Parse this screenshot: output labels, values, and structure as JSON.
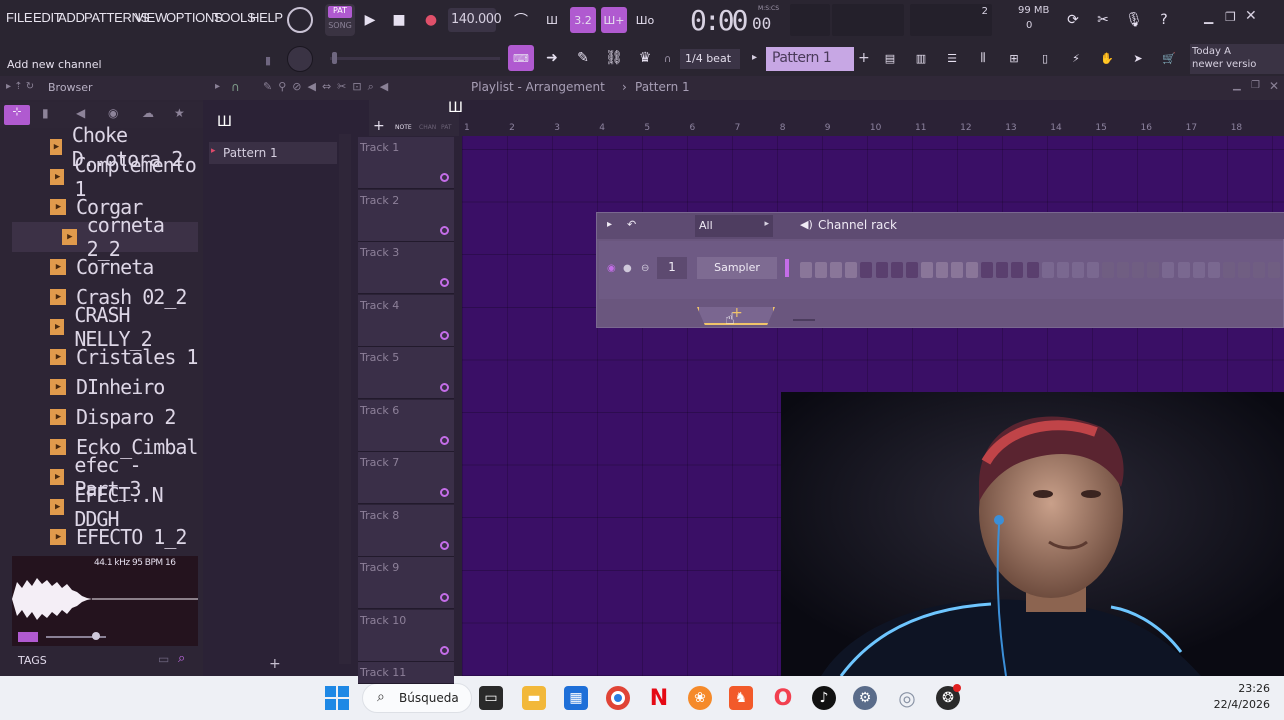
{
  "menu": {
    "items": [
      "FILE",
      "EDIT",
      "ADD",
      "PATTERNS",
      "VIEW",
      "OPTIONS",
      "TOOLS",
      "HELP"
    ]
  },
  "transport": {
    "pat_label": "PAT",
    "song_label": "SONG",
    "tempo": "140.000",
    "time": "0:00",
    "time_sub": "00",
    "time_unit": "M:S:CS",
    "cpu_val": "2",
    "mem": "99 MB",
    "mem_sub": "0",
    "small_val": "3.2"
  },
  "hint": {
    "text": "Add new channel"
  },
  "toolbar2": {
    "snap": "1/4 beat",
    "pattern": "Pattern 1",
    "news_line1": "Today  A",
    "news_line2": "newer versio"
  },
  "browser": {
    "title": "Browser",
    "items": [
      "Choke D..otora 2",
      "Complemento 1",
      "Corgar",
      "corneta 2_2",
      "Corneta",
      "Crash 02_2",
      "CRASH NELLY_2",
      "Cristales 1",
      "DInheiro",
      "Disparo 2",
      "Ecko_Cimbal",
      "efec - Part_3",
      "EFECT..N DDGH",
      "EFECTO 1_2"
    ],
    "selected_index": 3,
    "sample_info": "44.1 kHz 95 BPM 16",
    "tags_label": "TAGS"
  },
  "playlist": {
    "title": "Playlist - Arrangement",
    "breadcrumb_sep": "›",
    "pattern": "Pattern 1",
    "pattern_list": [
      "Pattern 1"
    ],
    "ruler": [
      "1",
      "2",
      "3",
      "4",
      "5",
      "6",
      "7",
      "8",
      "9",
      "10",
      "11",
      "12",
      "13",
      "14",
      "15",
      "16",
      "17",
      "18"
    ],
    "tracks": [
      "Track 1",
      "Track 2",
      "Track 3",
      "Track 4",
      "Track 5",
      "Track 6",
      "Track 7",
      "Track 8",
      "Track 9",
      "Track 10",
      "Track 11"
    ],
    "mode_labels": [
      "NOTE",
      "CHAN",
      "PAT"
    ]
  },
  "channel_rack": {
    "filter": "All",
    "title": "Channel rack",
    "channel_number": "1",
    "channel_name": "Sampler"
  },
  "taskbar": {
    "search": "Búsqueda",
    "time": "23:26",
    "date": "22/4/2026"
  },
  "colors": {
    "accent": "#c46de8",
    "grid": "#3a0f66",
    "panel": "#2b2236",
    "rack": "#6a567e"
  }
}
